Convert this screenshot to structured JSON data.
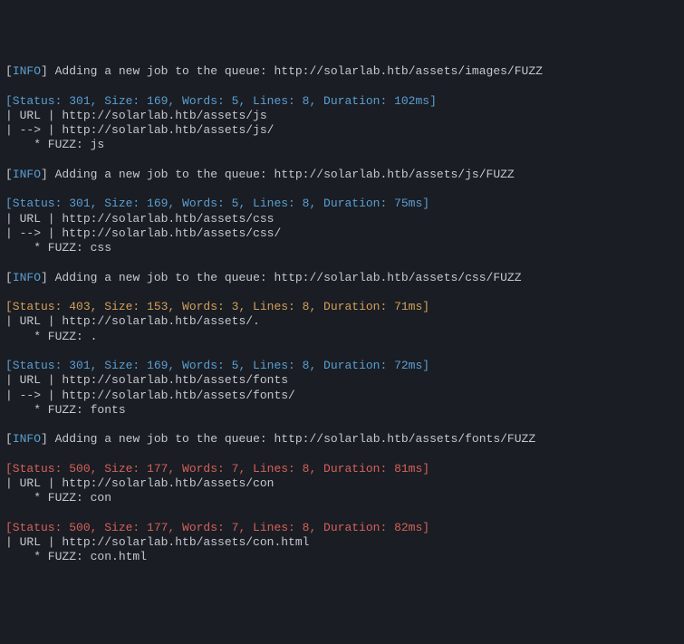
{
  "blocks": [
    {
      "type": "info",
      "text": "] Adding a new job to the queue: http://solarlab.htb/assets/images/FUZZ"
    },
    {
      "type": "blank"
    },
    {
      "type": "status",
      "code": "301",
      "line": "[Status: 301, Size: 169, Words: 5, Lines: 8, Duration: 102ms]"
    },
    {
      "type": "plain",
      "text": "| URL | http://solarlab.htb/assets/js"
    },
    {
      "type": "plain",
      "text": "| --> | http://solarlab.htb/assets/js/"
    },
    {
      "type": "plain",
      "text": "    * FUZZ: js"
    },
    {
      "type": "blank"
    },
    {
      "type": "info",
      "text": "] Adding a new job to the queue: http://solarlab.htb/assets/js/FUZZ"
    },
    {
      "type": "blank"
    },
    {
      "type": "status",
      "code": "301",
      "line": "[Status: 301, Size: 169, Words: 5, Lines: 8, Duration: 75ms]"
    },
    {
      "type": "plain",
      "text": "| URL | http://solarlab.htb/assets/css"
    },
    {
      "type": "plain",
      "text": "| --> | http://solarlab.htb/assets/css/"
    },
    {
      "type": "plain",
      "text": "    * FUZZ: css"
    },
    {
      "type": "blank"
    },
    {
      "type": "info",
      "text": "] Adding a new job to the queue: http://solarlab.htb/assets/css/FUZZ"
    },
    {
      "type": "blank"
    },
    {
      "type": "status",
      "code": "403",
      "line": "[Status: 403, Size: 153, Words: 3, Lines: 8, Duration: 71ms]"
    },
    {
      "type": "plain",
      "text": "| URL | http://solarlab.htb/assets/."
    },
    {
      "type": "plain",
      "text": "    * FUZZ: ."
    },
    {
      "type": "blank"
    },
    {
      "type": "status",
      "code": "301",
      "line": "[Status: 301, Size: 169, Words: 5, Lines: 8, Duration: 72ms]"
    },
    {
      "type": "plain",
      "text": "| URL | http://solarlab.htb/assets/fonts"
    },
    {
      "type": "plain",
      "text": "| --> | http://solarlab.htb/assets/fonts/"
    },
    {
      "type": "plain",
      "text": "    * FUZZ: fonts"
    },
    {
      "type": "blank"
    },
    {
      "type": "info",
      "text": "] Adding a new job to the queue: http://solarlab.htb/assets/fonts/FUZZ"
    },
    {
      "type": "blank"
    },
    {
      "type": "status",
      "code": "500",
      "line": "[Status: 500, Size: 177, Words: 7, Lines: 8, Duration: 81ms]"
    },
    {
      "type": "plain",
      "text": "| URL | http://solarlab.htb/assets/con"
    },
    {
      "type": "plain",
      "text": "    * FUZZ: con"
    },
    {
      "type": "blank"
    },
    {
      "type": "status",
      "code": "500",
      "line": "[Status: 500, Size: 177, Words: 7, Lines: 8, Duration: 82ms]"
    },
    {
      "type": "plain",
      "text": "| URL | http://solarlab.htb/assets/con.html"
    },
    {
      "type": "plain",
      "text": "    * FUZZ: con.html"
    }
  ],
  "labels": {
    "info": "INFO"
  }
}
